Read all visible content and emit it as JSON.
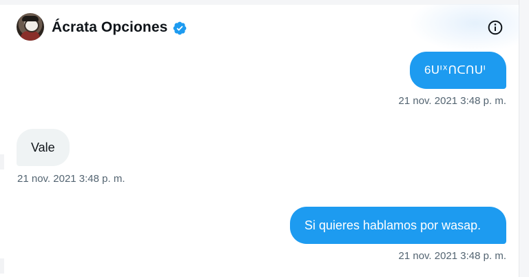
{
  "conversation": {
    "name": "Ácrata Opciones",
    "verified": true,
    "avatar_icon": "avatar-image",
    "info_icon": "info-icon",
    "accent_color": "#1d9bf0"
  },
  "messages": [
    {
      "direction": "outgoing",
      "text": "6ᑌᑊᕁᑎᑕᑎᑌᑊ",
      "timestamp": "21 nov. 2021 3:48 p. m."
    },
    {
      "direction": "incoming",
      "text": "Vale",
      "timestamp": "21 nov. 2021 3:48 p. m."
    },
    {
      "direction": "outgoing",
      "text": "Si quieres hablamos por wasap.",
      "timestamp": "21 nov. 2021 3:48 p. m."
    }
  ]
}
